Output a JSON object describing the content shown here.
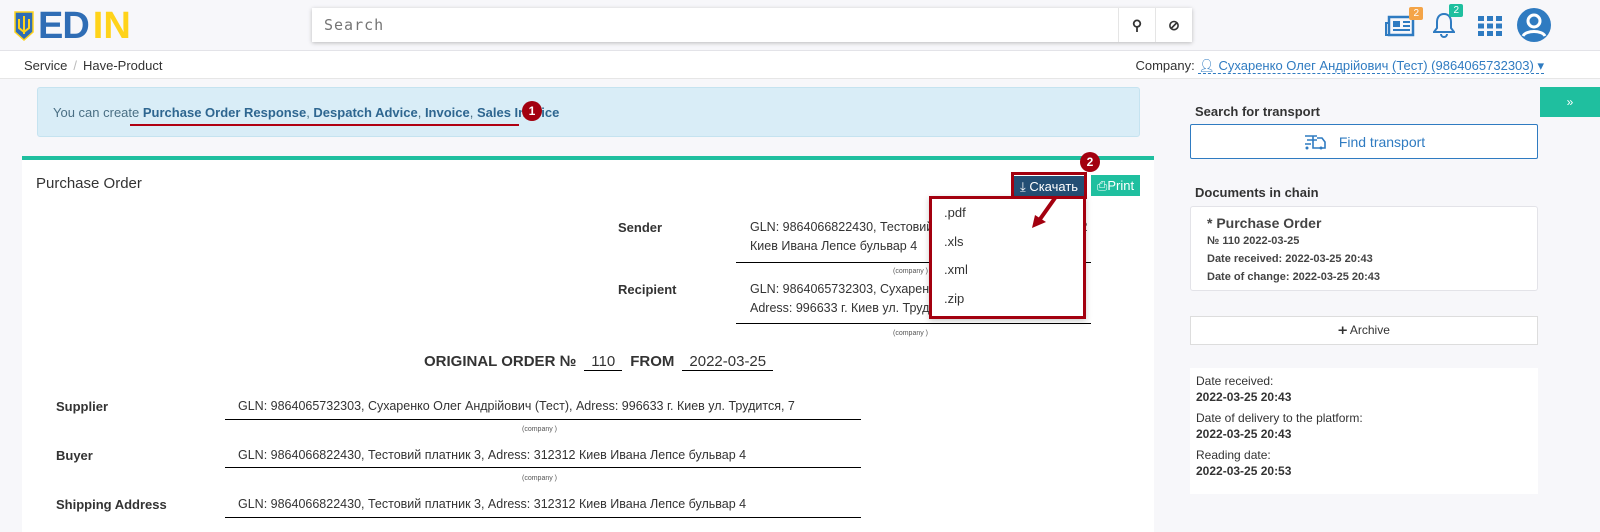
{
  "header": {
    "logo": "EDIN",
    "search_placeholder": "Search",
    "news_badge": "2",
    "notif_badge": "2"
  },
  "breadcrumb": {
    "items": [
      "Service",
      "Have-Product"
    ]
  },
  "company": {
    "label": "Company:",
    "name": "Сухаренко Олег Андрійович (Тест) (9864065732303)"
  },
  "alert": {
    "prefix": "You can create",
    "links": [
      "Purchase Order Response",
      "Despatch Advice",
      "Invoice",
      "Sales Invoice"
    ],
    "marker": "1"
  },
  "document": {
    "title": "Purchase Order",
    "download_label": "Скачать",
    "print_label": "Print",
    "marker": "2",
    "download_options": [
      ".pdf",
      ".xls",
      ".xml",
      ".zip"
    ],
    "sender_label": "Sender",
    "sender_value": "GLN: 9864066822430, Тестовий платник 3, Adress: 312312 Киев Ивана Лепсе бульвар 4",
    "recipient_label": "Recipient",
    "recipient_value": "GLN: 9864065732303, Сухаренко Олег Андрійович (Тест), Adress: 996633 г. Киев ул. Трудится, 7",
    "company_caption": "(company )",
    "order_heading": "ORIGINAL ORDER №",
    "order_number": "110",
    "from_label": "FROM",
    "order_date": "2022-03-25",
    "parties": [
      {
        "label": "Supplier",
        "value": "GLN: 9864065732303, Сухаренко Олег Андрійович (Тест), Adress: 996633 г. Киев ул. Трудится, 7"
      },
      {
        "label": "Buyer",
        "value": "GLN: 9864066822430, Тестовий платник 3, Adress: 312312 Киев Ивана Лепсе бульвар 4"
      },
      {
        "label": "Shipping Address",
        "value": "GLN: 9864066822430, Тестовий платник 3, Adress: 312312 Киев Ивана Лепсе бульвар 4"
      }
    ]
  },
  "sidebar": {
    "transport_heading": "Search for transport",
    "find_transport": "Find transport",
    "chain_heading": "Documents in chain",
    "chain_doc": {
      "title": "* Purchase Order",
      "number": "№ 110 2022-03-25",
      "received": "Date received: 2022-03-25 20:43",
      "changed": "Date of change: 2022-03-25 20:43"
    },
    "archive": "Archive",
    "dates": [
      {
        "label": "Date received:",
        "value": "2022-03-25 20:43"
      },
      {
        "label": "Date of delivery to the platform:",
        "value": "2022-03-25 20:43"
      },
      {
        "label": "Reading date:",
        "value": "2022-03-25 20:53"
      }
    ],
    "toggle": "»"
  },
  "colors": {
    "accent": "#1fbf9f",
    "brand_blue": "#2f6db5",
    "brand_yellow": "#ffd31a",
    "annotation": "#a3000f"
  }
}
